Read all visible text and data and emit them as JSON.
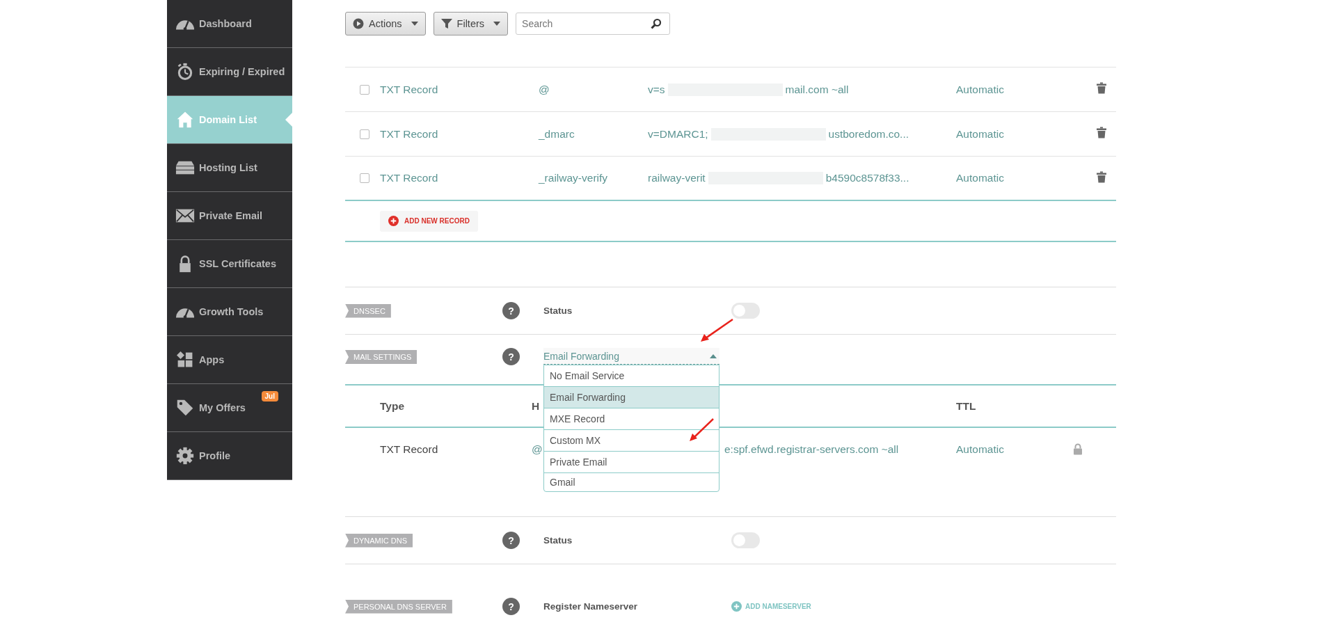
{
  "sidebar": {
    "items": [
      {
        "label": "Dashboard",
        "selected": false
      },
      {
        "label": "Expiring / Expired",
        "selected": false
      },
      {
        "label": "Domain List",
        "selected": true
      },
      {
        "label": "Hosting List",
        "selected": false
      },
      {
        "label": "Private Email",
        "selected": false
      },
      {
        "label": "SSL Certificates",
        "selected": false
      },
      {
        "label": "Growth Tools",
        "selected": false
      },
      {
        "label": "Apps",
        "selected": false
      },
      {
        "label": "My Offers",
        "selected": false,
        "badge": "Jul"
      },
      {
        "label": "Profile",
        "selected": false
      }
    ]
  },
  "toolbar": {
    "actions": "Actions",
    "filters": "Filters",
    "search": {
      "placeholder": "Search"
    }
  },
  "records": [
    {
      "checked": false,
      "type": "TXT Record",
      "host": "@",
      "value_start": "v=s",
      "redacted": true,
      "value_end": "mail.com ~all",
      "ttl": "Automatic"
    },
    {
      "checked": false,
      "type": "TXT Record",
      "host": "_dmarc",
      "value_start": "v=DMARC1;",
      "redacted": true,
      "value_end": "ustboredom.co...",
      "ttl": "Automatic"
    },
    {
      "checked": false,
      "type": "TXT Record",
      "host": "_railway-verify",
      "value_start": "railway-verit",
      "redacted": true,
      "value_end": "b4590c8578f33...",
      "ttl": "Automatic"
    }
  ],
  "add_record": "ADD NEW RECORD",
  "sections": [
    {
      "kind": "toggle",
      "tag": "DNSSEC",
      "help": "?",
      "label": "Status",
      "on": false
    },
    {
      "kind": "mail",
      "tag": "MAIL SETTINGS",
      "help": "?",
      "select": {
        "value": "Email Forwarding",
        "expanded": true,
        "options": [
          {
            "label": "No Email Service",
            "selected": false
          },
          {
            "label": "Email Forwarding",
            "selected": true
          },
          {
            "label": "MXE Record",
            "selected": false
          },
          {
            "label": "Custom MX",
            "selected": false
          },
          {
            "label": "Private Email",
            "selected": false
          },
          {
            "label": "Gmail",
            "selected": false
          }
        ]
      },
      "table": {
        "columns": [
          "Type",
          "H",
          "TTL"
        ],
        "rows": [
          {
            "type": "TXT Record",
            "host": "@",
            "value": "e:spf.efwd.registrar-servers.com ~all",
            "ttl": "Automatic"
          }
        ]
      }
    },
    {
      "kind": "toggle",
      "tag": "DYNAMIC DNS",
      "help": "?",
      "label": "Status",
      "on": false
    },
    {
      "kind": "nameserver",
      "tag": "PERSONAL DNS SERVER",
      "help": "?",
      "label": "Register Nameserver",
      "action": "ADD NAMESERVER"
    }
  ]
}
